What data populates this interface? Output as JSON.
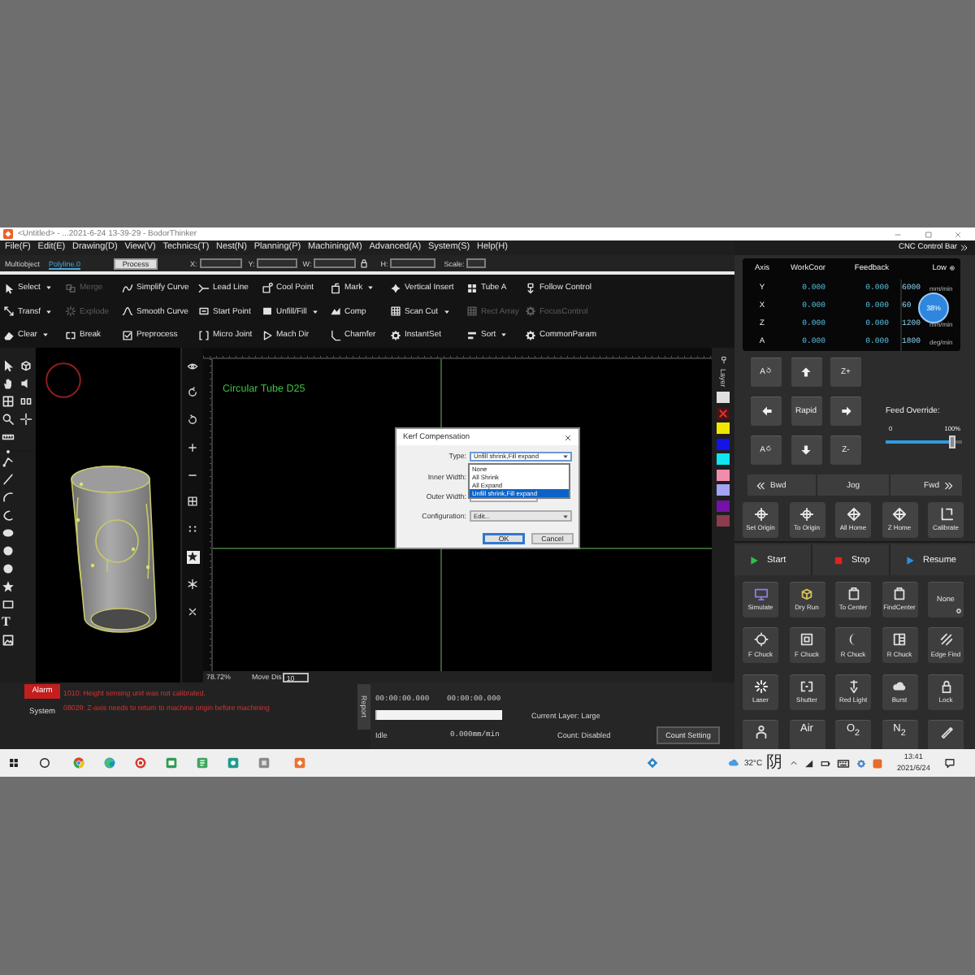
{
  "window": {
    "title": "<Untitled> - ...2021-6-24 13-39-29 - BodorThinker"
  },
  "menu": [
    "File(F)",
    "Edit(E)",
    "Drawing(D)",
    "View(V)",
    "Technics(T)",
    "Nest(N)",
    "Planning(P)",
    "Machining(M)",
    "Advanced(A)",
    "System(S)",
    "Help(H)"
  ],
  "property_bar": {
    "object": "Multiobject",
    "link": "Polyline.0",
    "process_button": "Process",
    "fields": [
      {
        "label": "X:"
      },
      {
        "label": "Y:"
      },
      {
        "label": "W:"
      },
      {
        "label": "H:"
      },
      {
        "label": "Scale:"
      }
    ]
  },
  "ribbon": {
    "rows": [
      {
        "tools": [
          {
            "label": "Select",
            "dropdown": true,
            "disabled": false
          },
          {
            "label": "Merge",
            "dropdown": false,
            "disabled": true
          },
          {
            "label": "Simplify Curve",
            "dropdown": false,
            "disabled": false
          },
          {
            "label": "Lead Line",
            "dropdown": false,
            "disabled": false
          },
          {
            "label": "Cool Point",
            "dropdown": false,
            "disabled": false
          },
          {
            "label": "Mark",
            "dropdown": true,
            "disabled": false
          },
          {
            "label": "Vertical Insert",
            "dropdown": false,
            "disabled": false
          },
          {
            "label": "Tube A",
            "dropdown": false,
            "disabled": false
          },
          {
            "label": "Follow Control",
            "dropdown": false,
            "disabled": false
          }
        ]
      },
      {
        "tools": [
          {
            "label": "Transf",
            "dropdown": true,
            "disabled": false
          },
          {
            "label": "Explode",
            "dropdown": false,
            "disabled": true
          },
          {
            "label": "Smooth Curve",
            "dropdown": false,
            "disabled": false
          },
          {
            "label": "Start Point",
            "dropdown": false,
            "disabled": false
          },
          {
            "label": "Unfill/Fill",
            "dropdown": true,
            "disabled": false
          },
          {
            "label": "Comp",
            "dropdown": false,
            "disabled": false
          },
          {
            "label": "Scan Cut",
            "dropdown": true,
            "disabled": false
          },
          {
            "label": "Rect Array",
            "dropdown": false,
            "disabled": true
          },
          {
            "label": "FocusControl",
            "dropdown": false,
            "disabled": true
          }
        ]
      },
      {
        "tools": [
          {
            "label": "Clear",
            "dropdown": true,
            "disabled": false
          },
          {
            "label": "Break",
            "dropdown": false,
            "disabled": false
          },
          {
            "label": "Preprocess",
            "dropdown": false,
            "disabled": false
          },
          {
            "label": "Micro Joint",
            "dropdown": false,
            "disabled": false
          },
          {
            "label": "Mach Dir",
            "dropdown": false,
            "disabled": false
          },
          {
            "label": "Chamfer",
            "dropdown": false,
            "disabled": false
          },
          {
            "label": "InstantSet",
            "dropdown": false,
            "disabled": false
          },
          {
            "label": "Sort",
            "dropdown": true,
            "disabled": false
          },
          {
            "label": "CommonParam",
            "dropdown": false,
            "disabled": false
          }
        ]
      }
    ]
  },
  "toolbox": {
    "text_tool": "T"
  },
  "view_toolbar": {
    "buttons": [
      {
        "on": false
      },
      {
        "on": false
      },
      {
        "on": false
      },
      {
        "on": false
      },
      {
        "on": false
      },
      {
        "on": false
      },
      {
        "on": false
      },
      {
        "on": true
      },
      {
        "on": false
      },
      {
        "on": false
      }
    ]
  },
  "canvas": {
    "title": "Circular Tube D25",
    "zoom": "78.72%",
    "move_label": "Move Dis",
    "move_value": "10"
  },
  "layers": {
    "label": "Layer",
    "swatches": [
      {
        "color": "#e0e0e0",
        "crossed": false
      },
      {
        "color": "#4a1414",
        "crossed": true
      },
      {
        "color": "#f2e600",
        "crossed": false
      },
      {
        "color": "#1414e6",
        "crossed": false
      },
      {
        "color": "#10e4f0",
        "crossed": false
      },
      {
        "color": "#f08cac",
        "crossed": false
      },
      {
        "color": "#a4a4f2",
        "crossed": false
      },
      {
        "color": "#7412a6",
        "crossed": false
      },
      {
        "color": "#8c3c4c",
        "crossed": false
      }
    ]
  },
  "dialog": {
    "title": "Kerf Compensation",
    "fields": [
      {
        "kind": "select",
        "label": "Type:",
        "value": "Unfill shrink,Fill expand"
      },
      {
        "kind": "input",
        "label": "Inner Width:"
      },
      {
        "kind": "input",
        "label": "Outer Width:"
      },
      {
        "kind": "select",
        "label": "Configuration:",
        "value": "Edit..."
      }
    ],
    "open_list": {
      "options": [
        {
          "label": "None",
          "selected": false
        },
        {
          "label": "All Shrink",
          "selected": false
        },
        {
          "label": "All Expand",
          "selected": false
        },
        {
          "label": "Unfill shrink,Fill expand",
          "selected": true
        }
      ]
    },
    "buttons": [
      {
        "label": "OK",
        "default": true
      },
      {
        "label": "Cancel",
        "default": false
      }
    ]
  },
  "log": {
    "tabs": [
      {
        "label": "Alarm",
        "selected": true
      },
      {
        "label": "System",
        "selected": false
      }
    ],
    "messages": [
      "1010: Height sensing unit was not calibrated.",
      "08029: Z-axis needs to return to machine origin before machining"
    ],
    "report_tab": "Report"
  },
  "job_status": {
    "elapsed": "00:00:00.000",
    "total": "00:00:00.000",
    "progress": {
      "level": 0
    },
    "current_layer": "Current Layer: Large",
    "state": "Idle",
    "speed": "0.000mm/min",
    "count": "Count: Disabled",
    "count_button": "Count Setting"
  },
  "cnc": {
    "title": "CNC Control Bar",
    "axes": {
      "columns": [
        "Axis",
        "WorkCoor",
        "Feedback"
      ],
      "speed_mode": "Low",
      "rows": [
        {
          "axis": "Y",
          "work": "0.000",
          "feedback": "0.000",
          "speed": "6000",
          "unit": "mm/min"
        },
        {
          "axis": "X",
          "work": "0.000",
          "feedback": "0.000",
          "speed": "60"
        },
        {
          "axis": "Z",
          "work": "0.000",
          "feedback": "0.000",
          "speed": "1200",
          "unit": "mm/min"
        },
        {
          "axis": "A",
          "work": "0.000",
          "feedback": "0.000",
          "speed": "1800",
          "unit": "deg/min"
        }
      ]
    },
    "overlay_badge": "38%",
    "jog": {
      "buttons": [
        {
          "kind": "rotate",
          "label": "A"
        },
        {
          "kind": "arrow"
        },
        {
          "kind": "axis",
          "label": "Z+"
        },
        {
          "kind": "arrow"
        },
        {
          "kind": "text",
          "label": "Rapid"
        },
        {
          "kind": "arrow"
        },
        {
          "kind": "rotate",
          "label": "A"
        },
        {
          "kind": "arrow"
        },
        {
          "kind": "axis",
          "label": "Z-"
        }
      ]
    },
    "feed_override": {
      "label": "Feed Override:",
      "min": "0",
      "max": "100%",
      "level": 0.88
    },
    "jog_bar": {
      "back": "Bwd",
      "mode": "Jog",
      "forward": "Fwd"
    },
    "origin_buttons": [
      "Set Origin",
      "To Origin",
      "All Home",
      "Z Home",
      "Calibrate"
    ],
    "run_buttons": [
      {
        "kind": "start",
        "label": "Start"
      },
      {
        "kind": "stop",
        "label": "Stop"
      },
      {
        "kind": "resume",
        "label": "Resume"
      }
    ],
    "function_buttons": [
      {
        "kind": "icon",
        "label": "Simulate"
      },
      {
        "kind": "icon",
        "label": "Dry Run"
      },
      {
        "kind": "icon",
        "label": "To Center"
      },
      {
        "kind": "icon",
        "label": "FindCenter"
      },
      {
        "kind": "select",
        "label": "None"
      },
      {
        "kind": "icon",
        "label": "F Chuck"
      },
      {
        "kind": "icon",
        "label": "F Chuck"
      },
      {
        "kind": "icon",
        "label": "R Chuck"
      },
      {
        "kind": "icon",
        "label": "R Chuck"
      },
      {
        "kind": "icon",
        "label": "Edge Find"
      },
      {
        "kind": "icon",
        "label": "Laser"
      },
      {
        "kind": "icon",
        "label": "Shutter"
      },
      {
        "kind": "icon",
        "label": "Red Light"
      },
      {
        "kind": "icon",
        "label": "Burst"
      },
      {
        "kind": "icon",
        "label": "Lock"
      },
      {
        "kind": "icon"
      },
      {
        "kind": "text",
        "label": "Air"
      },
      {
        "kind": "text",
        "label": "O$_{2}$"
      },
      {
        "kind": "text",
        "label": "N$_{2}$"
      },
      {
        "kind": "icon"
      }
    ]
  },
  "taskbar": {
    "temperature": "32°C",
    "condition": "阴",
    "time": "13:41",
    "date": "2021/6/24"
  }
}
